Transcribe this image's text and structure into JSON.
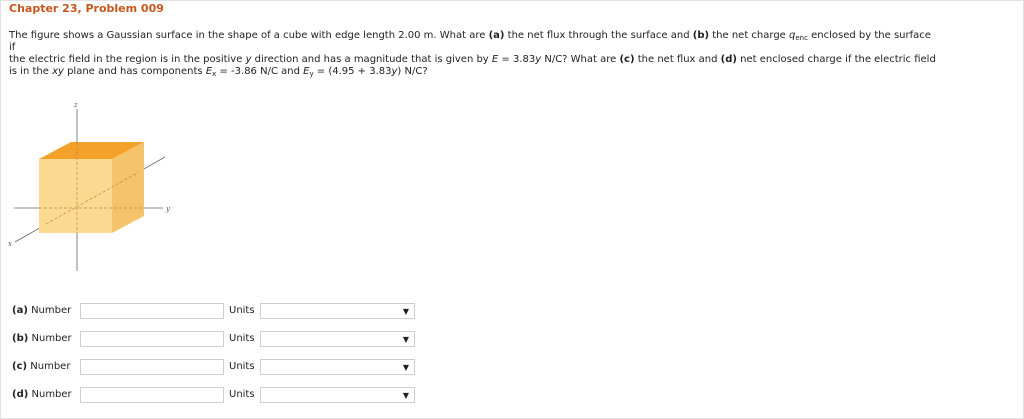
{
  "header": {
    "title": "Chapter 23, Problem 009"
  },
  "problem": {
    "line1": {
      "p1": "The figure shows a Gaussian surface in the shape of a cube with edge length 2.00 m. What are ",
      "a": "(a)",
      "p2": " the net flux through the surface and ",
      "b": "(b)",
      "p3": " the net charge ",
      "q": "q",
      "q_sub": "enc",
      "p4": " enclosed by the surface"
    },
    "line2": "if",
    "line3": {
      "p1": "the electric field in the region is in the positive ",
      "y1": "y",
      "p2": " direction and has a magnitude that is given by ",
      "E": "E",
      "p3": " = 3.83",
      "y2": "y",
      "p4": " N/C? What are ",
      "c": "(c)",
      "p5": " the net flux and ",
      "d": "(d)",
      "p6": " net enclosed charge if the electric field"
    },
    "line4": {
      "p1": "is in the ",
      "xy": "xy",
      "p2": " plane and has components ",
      "Ex": "E",
      "Ex_sub": "x",
      "p3": " = -3.86 N/C and ",
      "Ey": "E",
      "Ey_sub": "y",
      "p4": " = (4.95 + 3.83",
      "y": "y",
      "p5": ") N/C?"
    }
  },
  "figure": {
    "axis_z": "z",
    "axis_y": "y",
    "axis_x": "x",
    "cube_top_color": "#f4a12b",
    "cube_front_color": "#fbd990",
    "cube_side_color": "#f5c46a"
  },
  "answers": [
    {
      "part": "(a)",
      "label": "Number",
      "value": "",
      "units_label": "Units",
      "units_value": ""
    },
    {
      "part": "(b)",
      "label": "Number",
      "value": "",
      "units_label": "Units",
      "units_value": ""
    },
    {
      "part": "(c)",
      "label": "Number",
      "value": "",
      "units_label": "Units",
      "units_value": ""
    },
    {
      "part": "(d)",
      "label": "Number",
      "value": "",
      "units_label": "Units",
      "units_value": ""
    }
  ],
  "icons": {
    "dropdown": "chevron-down-icon",
    "dropdown_glyph": "▼"
  }
}
